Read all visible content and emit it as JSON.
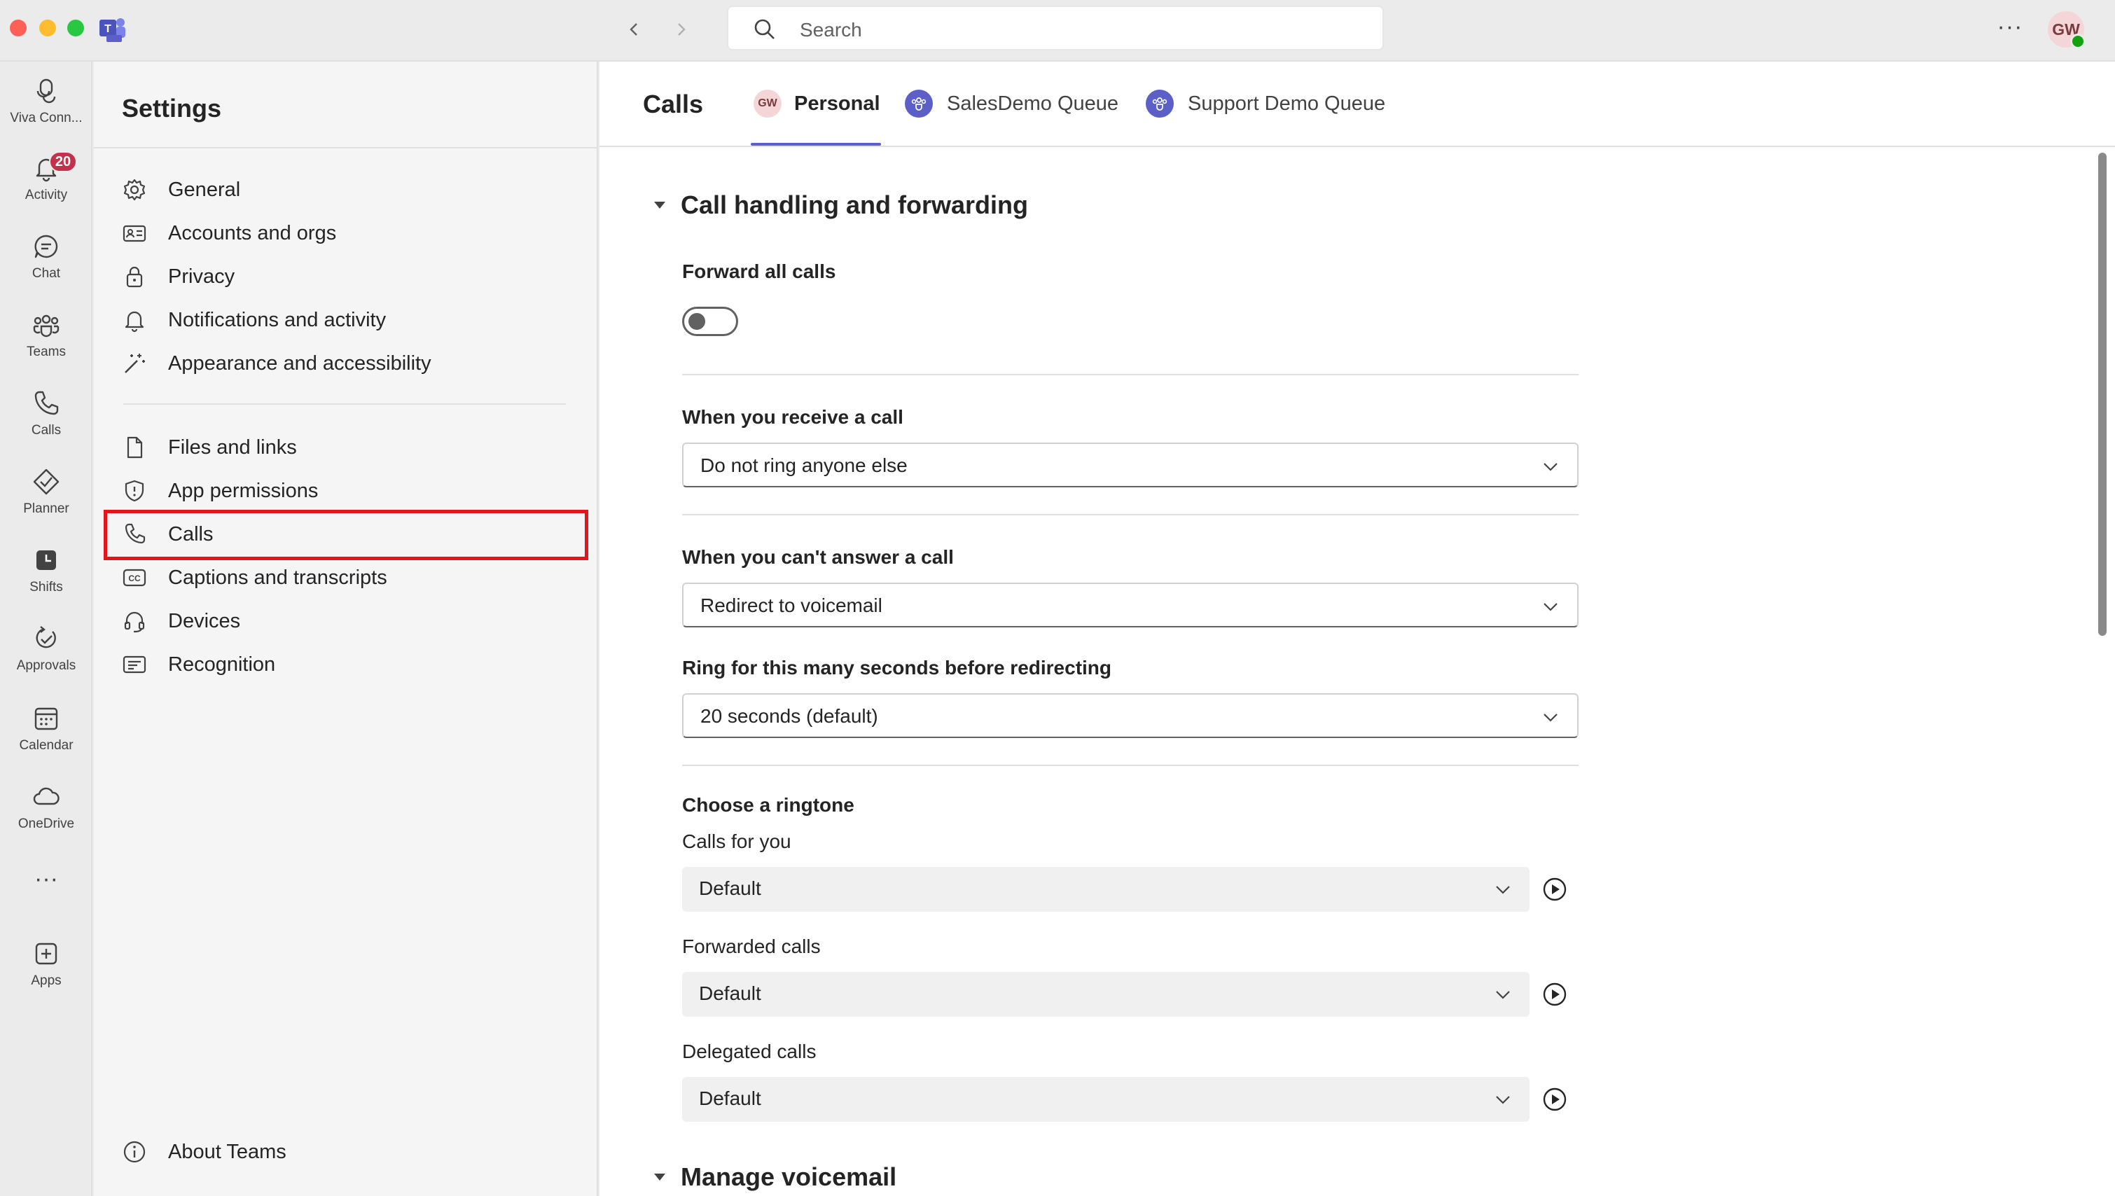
{
  "titlebar": {
    "search_placeholder": "Search",
    "more_label": "···",
    "avatar_initials": "GW"
  },
  "rail": {
    "items": [
      {
        "label": "Viva Conn...",
        "icon": "viva-connections-icon"
      },
      {
        "label": "Activity",
        "icon": "bell-icon",
        "badge": "20"
      },
      {
        "label": "Chat",
        "icon": "chat-icon"
      },
      {
        "label": "Teams",
        "icon": "teams-icon"
      },
      {
        "label": "Calls",
        "icon": "phone-icon"
      },
      {
        "label": "Planner",
        "icon": "planner-icon"
      },
      {
        "label": "Shifts",
        "icon": "shifts-icon"
      },
      {
        "label": "Approvals",
        "icon": "approvals-icon"
      },
      {
        "label": "Calendar",
        "icon": "calendar-icon"
      },
      {
        "label": "OneDrive",
        "icon": "cloud-icon"
      },
      {
        "label": "",
        "icon": "more-icon",
        "glyph": "···"
      },
      {
        "label": "Apps",
        "icon": "add-apps-icon"
      }
    ]
  },
  "settings": {
    "title": "Settings",
    "items": [
      {
        "label": "General",
        "icon": "gear-icon"
      },
      {
        "label": "Accounts and orgs",
        "icon": "id-card-icon"
      },
      {
        "label": "Privacy",
        "icon": "lock-icon"
      },
      {
        "label": "Notifications and activity",
        "icon": "bell-icon"
      },
      {
        "label": "Appearance and accessibility",
        "icon": "magic-wand-icon"
      },
      {
        "label": "Files and links",
        "icon": "file-icon"
      },
      {
        "label": "App permissions",
        "icon": "shield-icon"
      },
      {
        "label": "Calls",
        "icon": "phone-icon"
      },
      {
        "label": "Captions and transcripts",
        "icon": "closed-captions-icon"
      },
      {
        "label": "Devices",
        "icon": "headset-icon"
      },
      {
        "label": "Recognition",
        "icon": "recognition-icon"
      }
    ],
    "about": {
      "label": "About Teams",
      "icon": "info-icon"
    }
  },
  "main": {
    "title": "Calls",
    "tabs": [
      {
        "label": "Personal",
        "avatar": "GW",
        "active": true
      },
      {
        "label": "SalesDemo Queue",
        "icon": "call-queue-icon"
      },
      {
        "label": "Support Demo Queue",
        "icon": "call-queue-icon"
      }
    ],
    "section_call_handling": "Call handling and forwarding",
    "forward_all": {
      "label": "Forward all calls",
      "on": false
    },
    "receive": {
      "label": "When you receive a call",
      "value": "Do not ring anyone else"
    },
    "cant_answer": {
      "label": "When you can't answer a call",
      "value": "Redirect to voicemail"
    },
    "ring_seconds": {
      "label": "Ring for this many seconds before redirecting",
      "value": "20 seconds (default)"
    },
    "ringtone": {
      "label": "Choose a ringtone",
      "calls_for_you": {
        "label": "Calls for you",
        "value": "Default"
      },
      "forwarded": {
        "label": "Forwarded calls",
        "value": "Default"
      },
      "delegated": {
        "label": "Delegated calls",
        "value": "Default"
      }
    },
    "section_voicemail": "Manage voicemail"
  }
}
